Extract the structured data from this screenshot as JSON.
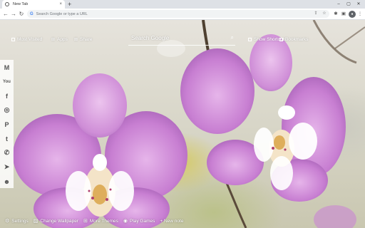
{
  "browser": {
    "tab_title": "New Tab",
    "tab_close": "×",
    "new_tab": "+",
    "win_minimize": "–",
    "win_maximize": "▢",
    "win_close": "✕",
    "omnibox_placeholder": "Search Google or type a URL"
  },
  "toplinks": {
    "most_visited": "Most Visited",
    "apps": "Apps",
    "share": "Share",
    "show_shortcuts": "Show Shortcuts",
    "bookmarks": "Bookmarks"
  },
  "search": {
    "placeholder": "Search Google"
  },
  "social": [
    {
      "name": "gmail",
      "glyph": "M"
    },
    {
      "name": "youtube",
      "glyph": "You"
    },
    {
      "name": "facebook",
      "glyph": "f"
    },
    {
      "name": "instagram",
      "glyph": "◎"
    },
    {
      "name": "pinterest",
      "glyph": "P"
    },
    {
      "name": "twitter",
      "glyph": "t"
    },
    {
      "name": "whatsapp",
      "glyph": "✆"
    },
    {
      "name": "telegram",
      "glyph": "➤"
    },
    {
      "name": "reddit",
      "glyph": "☻"
    }
  ],
  "bottombar": {
    "settings": "Settings",
    "change_wallpaper": "Change Wallpaper",
    "more_themes": "More Themes",
    "play_games": "Play Games",
    "new_note": "+ New note"
  },
  "colors": {
    "orchid": "#c77fd0",
    "orchid_dark": "#a85fb8",
    "stem": "#5a4a3a"
  }
}
